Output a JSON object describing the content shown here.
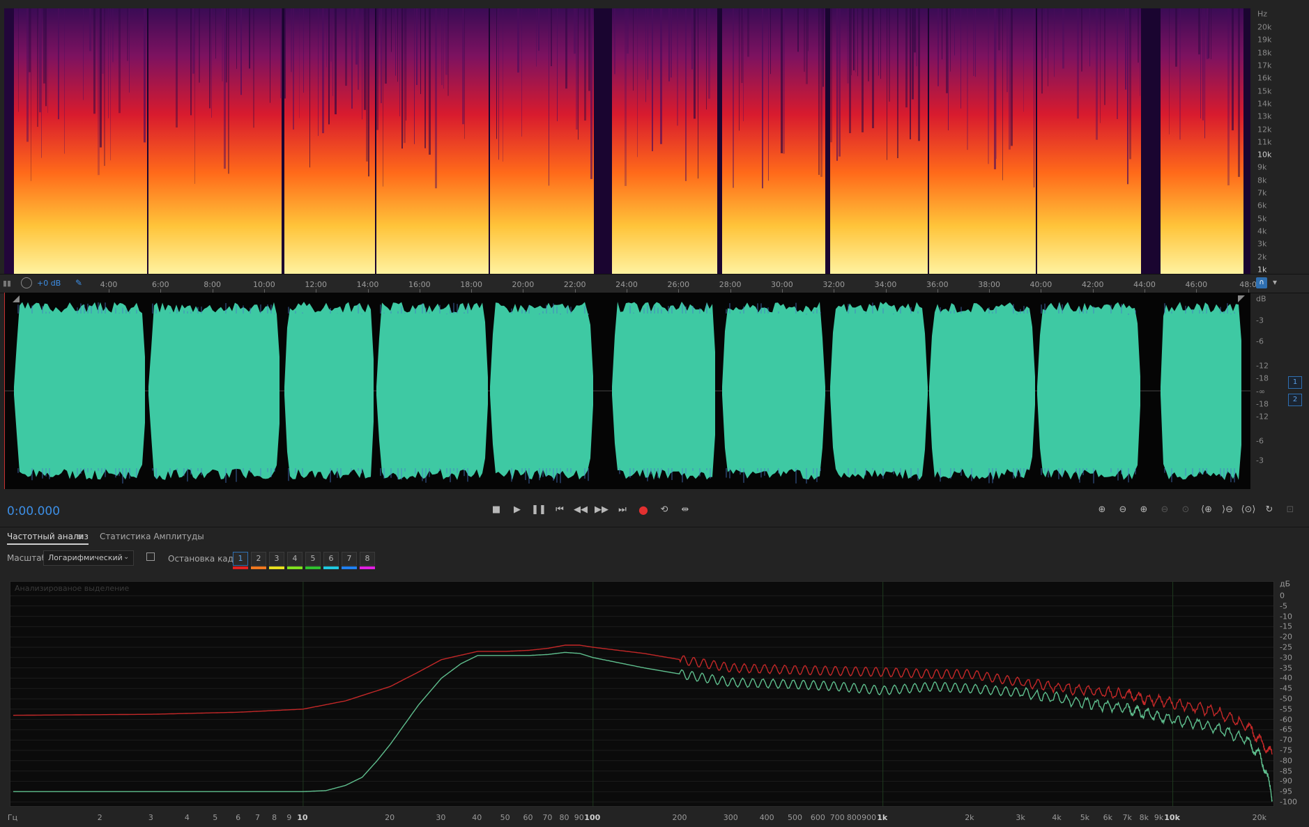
{
  "spectral_scale": {
    "unit": "Hz",
    "labels": [
      "20k",
      "19k",
      "18k",
      "17k",
      "16k",
      "15k",
      "14k",
      "13k",
      "12k",
      "11k",
      "10k",
      "9k",
      "8k",
      "7k",
      "6k",
      "5k",
      "4k",
      "3k",
      "2k",
      "1k"
    ]
  },
  "ruler": {
    "gain": "+0 dB",
    "ticks": [
      "4:00",
      "6:00",
      "8:00",
      "10:00",
      "12:00",
      "14:00",
      "16:00",
      "18:00",
      "20:00",
      "22:00",
      "24:00",
      "26:00",
      "28:00",
      "30:00",
      "32:00",
      "34:00",
      "36:00",
      "38:00",
      "40:00",
      "42:00",
      "44:00",
      "46:00",
      "48:0"
    ]
  },
  "waveform": {
    "unit": "dB",
    "labels": [
      "-3",
      "-6",
      "-12",
      "-18",
      "-∞",
      "-18",
      "-12",
      "-6",
      "-3"
    ],
    "channels": [
      "1",
      "2"
    ],
    "color": "#3ec9a3"
  },
  "transport": {
    "timecode": "0:00.000",
    "buttons": [
      "stop",
      "play",
      "pause",
      "go-to-start",
      "rewind",
      "fast-forward",
      "go-to-end",
      "record",
      "loop",
      "skip-selection"
    ]
  },
  "panel": {
    "tabs": [
      "Частотный анализ",
      "Статистика Амплитуды"
    ],
    "scale_label": "Масштаб:",
    "scale_value": "Логарифмический",
    "freeze_label": "Остановка кадра:",
    "frames": [
      "1",
      "2",
      "3",
      "4",
      "5",
      "6",
      "7",
      "8"
    ],
    "frame_colors": [
      "#e02020",
      "#f07820",
      "#e8e020",
      "#80e020",
      "#30c030",
      "#20c8e0",
      "#2080f0",
      "#e020e0"
    ],
    "analyzed_label": "Анализированое выделение"
  },
  "chart_data": {
    "type": "line",
    "x_scale": "log",
    "xlim": [
      1,
      22000
    ],
    "ylim": [
      -100,
      0
    ],
    "xlabel": "Гц",
    "ylabel": "дБ",
    "x_ticks": [
      "Гц",
      "2",
      "3",
      "4",
      "5",
      "6",
      "7",
      "8",
      "9",
      "10",
      "20",
      "30",
      "40",
      "50",
      "60",
      "70",
      "80",
      "90",
      "100",
      "200",
      "300",
      "400",
      "500",
      "600",
      "700",
      "800",
      "900",
      "1k",
      "2k",
      "3k",
      "4k",
      "5k",
      "6k",
      "7k",
      "8k",
      "9k",
      "10k",
      "20k"
    ],
    "y_ticks": [
      "0",
      "-5",
      "-10",
      "-15",
      "-20",
      "-25",
      "-30",
      "-35",
      "-40",
      "-45",
      "-50",
      "-55",
      "-60",
      "-65",
      "-70",
      "-75",
      "-80",
      "-85",
      "-90",
      "-95",
      "-100"
    ],
    "series": [
      {
        "color": "#c42828",
        "points": [
          [
            1,
            -58
          ],
          [
            3,
            -57.5
          ],
          [
            6,
            -56.5
          ],
          [
            10,
            -55
          ],
          [
            14,
            -51
          ],
          [
            20,
            -44
          ],
          [
            25,
            -37
          ],
          [
            30,
            -31
          ],
          [
            40,
            -27
          ],
          [
            50,
            -27
          ],
          [
            60,
            -26.5
          ],
          [
            70,
            -25.5
          ],
          [
            80,
            -24
          ],
          [
            90,
            -24
          ],
          [
            100,
            -25
          ],
          [
            150,
            -28
          ],
          [
            200,
            -31
          ],
          [
            300,
            -35
          ],
          [
            500,
            -36
          ],
          [
            700,
            -36.5
          ],
          [
            1000,
            -37
          ],
          [
            1500,
            -38
          ],
          [
            2000,
            -38
          ],
          [
            3000,
            -42
          ],
          [
            5000,
            -46
          ],
          [
            7000,
            -48
          ],
          [
            8000,
            -50
          ],
          [
            10000,
            -52
          ],
          [
            14000,
            -56
          ],
          [
            18000,
            -63
          ],
          [
            20000,
            -70
          ],
          [
            22000,
            -77
          ]
        ]
      },
      {
        "color": "#5fbf8e",
        "points": [
          [
            1,
            -95
          ],
          [
            5,
            -95
          ],
          [
            10,
            -95
          ],
          [
            12,
            -94.5
          ],
          [
            14,
            -92
          ],
          [
            16,
            -88
          ],
          [
            18,
            -80
          ],
          [
            20,
            -72
          ],
          [
            25,
            -53
          ],
          [
            30,
            -40
          ],
          [
            35,
            -33
          ],
          [
            40,
            -29
          ],
          [
            50,
            -29
          ],
          [
            60,
            -29
          ],
          [
            70,
            -28.5
          ],
          [
            80,
            -27.5
          ],
          [
            90,
            -28
          ],
          [
            100,
            -30
          ],
          [
            150,
            -35
          ],
          [
            200,
            -38
          ],
          [
            300,
            -42
          ],
          [
            500,
            -43
          ],
          [
            700,
            -44
          ],
          [
            1000,
            -46
          ],
          [
            1500,
            -44
          ],
          [
            2000,
            -45
          ],
          [
            3000,
            -47
          ],
          [
            5000,
            -52
          ],
          [
            7000,
            -55
          ],
          [
            8000,
            -57
          ],
          [
            10000,
            -60
          ],
          [
            14000,
            -64
          ],
          [
            18000,
            -70
          ],
          [
            20000,
            -78
          ],
          [
            21000,
            -85
          ],
          [
            22000,
            -99
          ]
        ]
      }
    ]
  }
}
